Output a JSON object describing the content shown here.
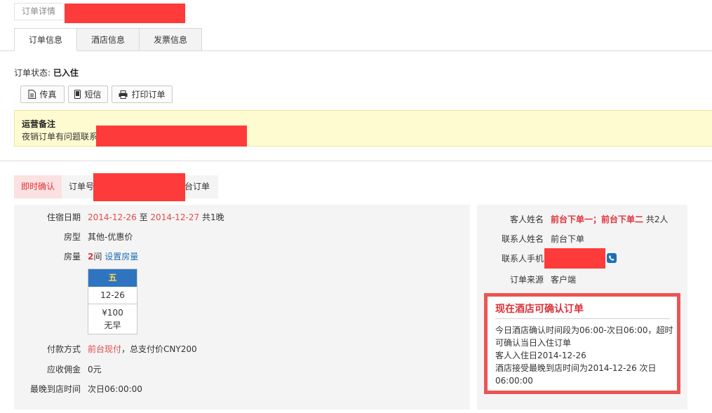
{
  "header": {
    "title": "订单详情"
  },
  "tabs": [
    {
      "label": "订单信息",
      "active": true
    },
    {
      "label": "酒店信息",
      "active": false
    },
    {
      "label": "发票信息",
      "active": false
    }
  ],
  "status": {
    "label": "订单状态:",
    "value": "已入住"
  },
  "toolbar": {
    "fax_label": "传真",
    "sms_label": "短信",
    "print_label": "打印订单"
  },
  "ops_note": {
    "title": "运营备注",
    "text": "夜销订单有问题联系"
  },
  "order_bar": {
    "badge": "即时确认",
    "order_prefix": "订单号",
    "order_suffix": "台订单"
  },
  "stay": {
    "date_label": "住宿日期",
    "check_in": "2014-12-26",
    "to": "至",
    "check_out": "2014-12-27",
    "nights": "共1晚",
    "room_type_label": "房型",
    "room_type": "其他-优惠价",
    "room_qty_label": "房量",
    "room_qty": "2",
    "room_unit": "间",
    "set_rooms_link": "设置房量",
    "calendar": {
      "weekday": "五",
      "date": "12-26",
      "price": "¥100",
      "breakfast": "无早"
    },
    "payment_label": "付款方式",
    "payment_method": "前台现付",
    "payment_total": "，总支付价CNY200",
    "commission_label": "应收佣金",
    "commission": "0元",
    "latest_arrival_label": "最晚到店时间",
    "latest_arrival": "次日06:00:00"
  },
  "guest": {
    "name_label": "客人姓名",
    "names": "前台下单一；前台下单二",
    "count": "共2人",
    "contact_label": "联系人姓名",
    "contact": "前台下单",
    "phone_label": "联系人手机",
    "source_label": "订单来源",
    "source": "客户端"
  },
  "confirm": {
    "title": "现在酒店可确认订单",
    "lines": [
      "今日酒店确认时间段为06:00-次日06:00，超时可确认当日入住订单",
      "客人入住日2014-12-26",
      "酒店接受最晚到店时间为2014-12-26 次日06:00:00"
    ]
  },
  "colors": {
    "accent_red": "#e0323a",
    "link_blue": "#1f6fb5",
    "note_bg": "#fffbd0",
    "calendar_head": "#2f74c0"
  }
}
